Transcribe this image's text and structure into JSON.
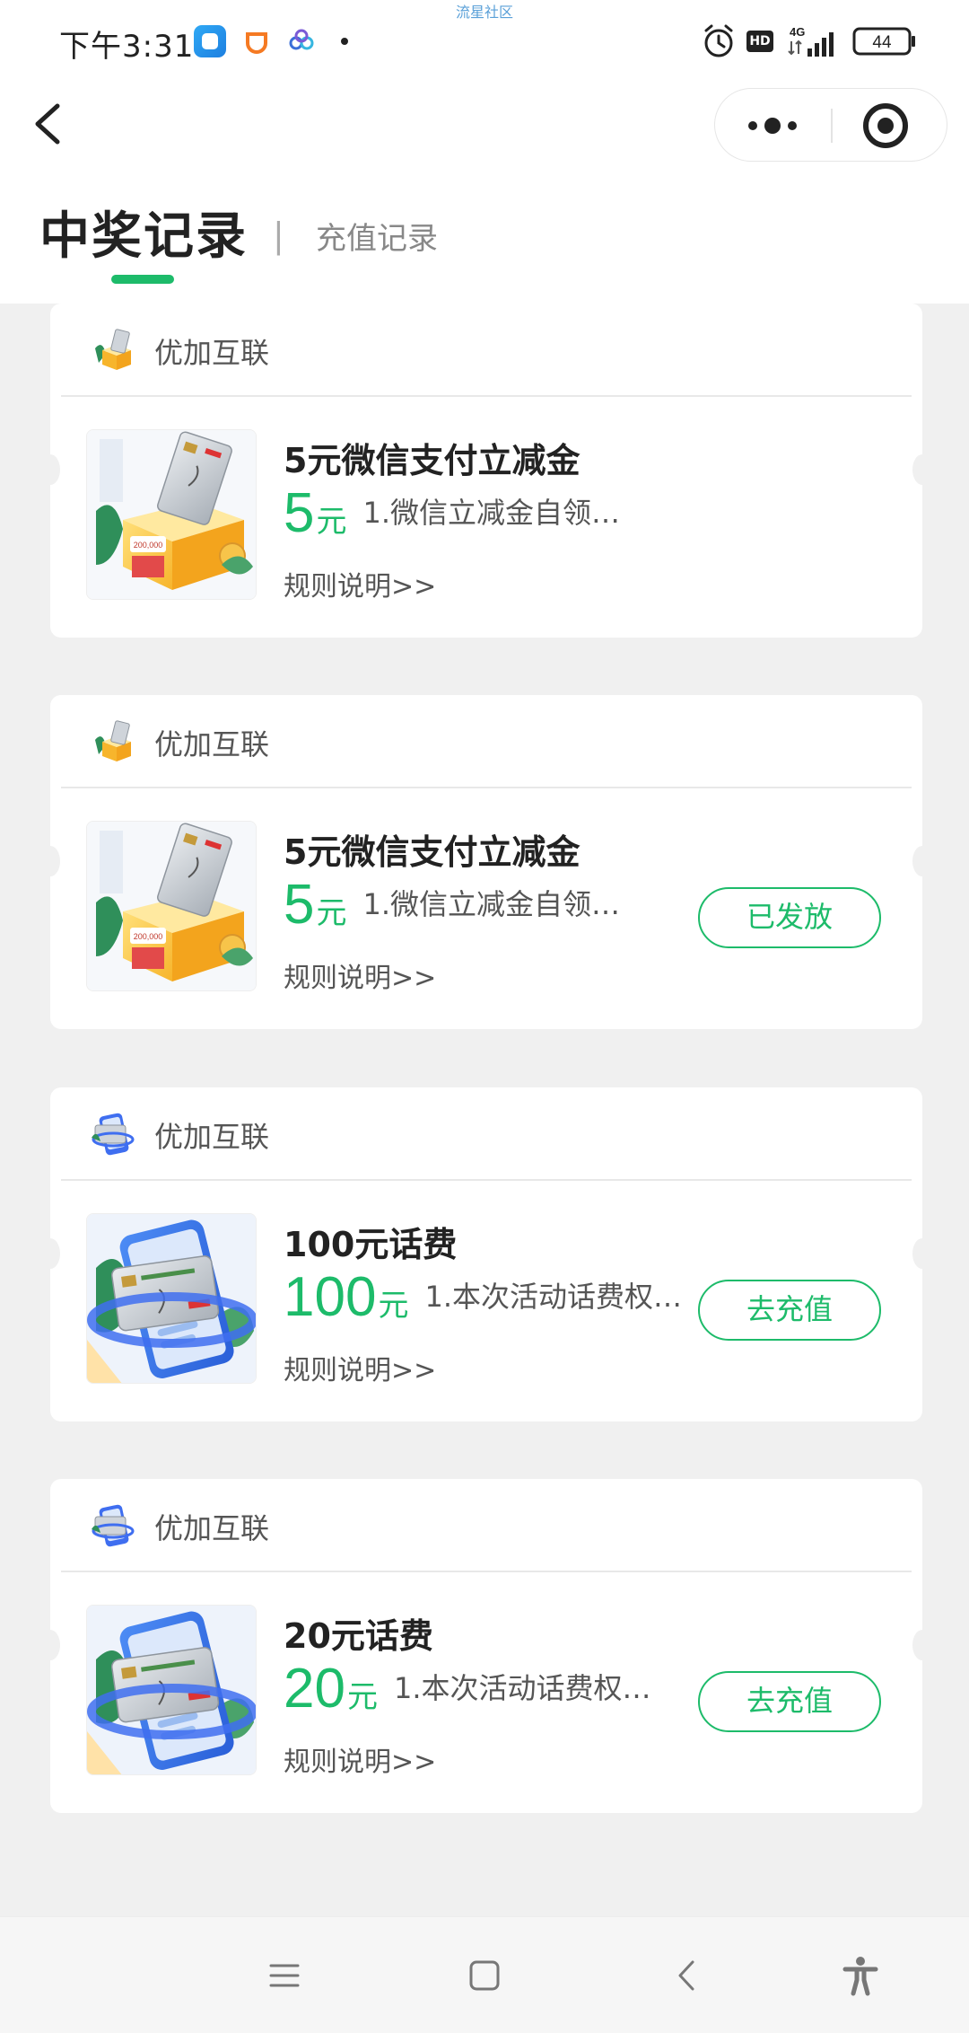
{
  "status_bar": {
    "time": "下午3:31",
    "watermark": "流星社区",
    "network": "4G",
    "hd": "HD",
    "battery": "44"
  },
  "nav": {
    "back_icon": "back-chevron-icon",
    "more_icon": "more-dots-icon",
    "close_icon": "target-close-icon"
  },
  "tabs": {
    "active": "中奖记录",
    "separator": "|",
    "inactive": "充值记录"
  },
  "colors": {
    "accent": "#1dbb6a",
    "background": "#f0f0f0"
  },
  "cards": [
    {
      "merchant": "优加互联",
      "merchant_icon": "gift-box-icon",
      "image": "card-box-illustration",
      "title": "5元微信支付立减金",
      "amount": "5",
      "unit": "元",
      "desc": "1.微信立减金自领…",
      "rules": "规则说明>>",
      "button": null
    },
    {
      "merchant": "优加互联",
      "merchant_icon": "gift-box-icon",
      "image": "card-box-illustration",
      "title": "5元微信支付立减金",
      "amount": "5",
      "unit": "元",
      "desc": "1.微信立减金自领…",
      "rules": "规则说明>>",
      "button": "已发放"
    },
    {
      "merchant": "优加互联",
      "merchant_icon": "phone-card-icon",
      "image": "phone-card-illustration",
      "title": "100元话费",
      "amount": "100",
      "unit": "元",
      "desc": "1.本次活动话费权…",
      "rules": "规则说明>>",
      "button": "去充值"
    },
    {
      "merchant": "优加互联",
      "merchant_icon": "phone-card-icon",
      "image": "phone-card-illustration",
      "title": "20元话费",
      "amount": "20",
      "unit": "元",
      "desc": "1.本次活动话费权…",
      "rules": "规则说明>>",
      "button": "去充值"
    }
  ],
  "system_nav": {
    "menu_icon": "menu-icon",
    "home_icon": "home-icon",
    "back_icon": "back-icon",
    "accessibility_icon": "accessibility-icon"
  }
}
